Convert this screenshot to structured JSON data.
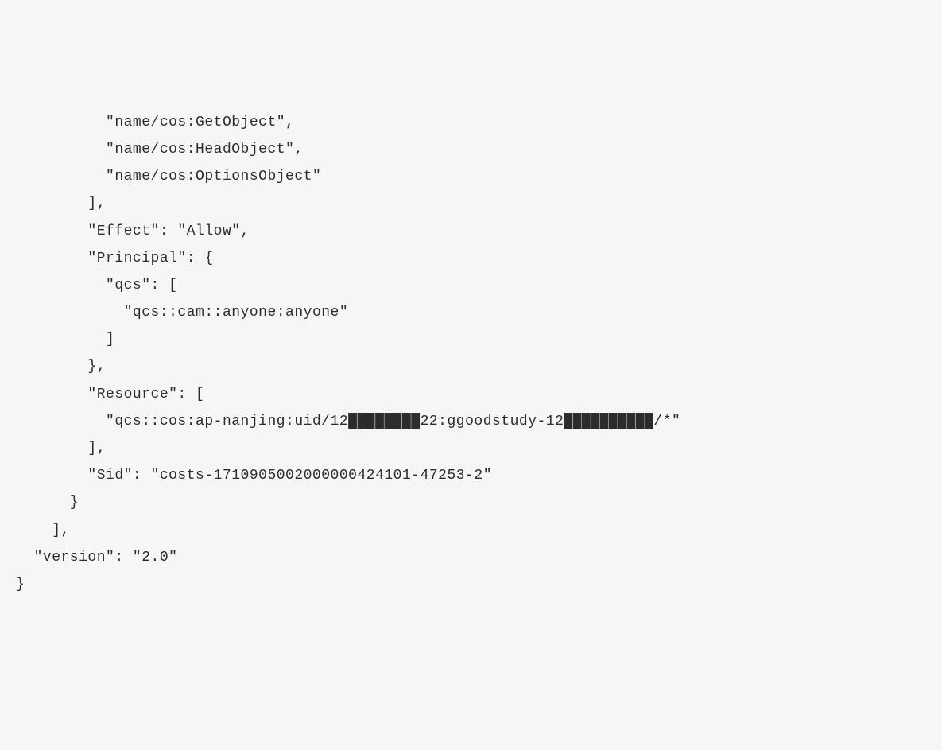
{
  "code": {
    "lines": [
      "          \"name/cos:GetObject\",",
      "          \"name/cos:HeadObject\",",
      "          \"name/cos:OptionsObject\"",
      "        ],",
      "        \"Effect\": \"Allow\",",
      "        \"Principal\": {",
      "          \"qcs\": [",
      "            \"qcs::cam::anyone:anyone\"",
      "          ]",
      "        },",
      "        \"Resource\": [",
      "          \"qcs::cos:ap-nanjing:uid/12████████22:ggoodstudy-12██████████/*\"",
      "        ],",
      "        \"Sid\": \"costs-1710905002000000424101-47253-2\"",
      "      }",
      "    ],",
      "  \"version\": \"2.0\"",
      "}"
    ]
  }
}
